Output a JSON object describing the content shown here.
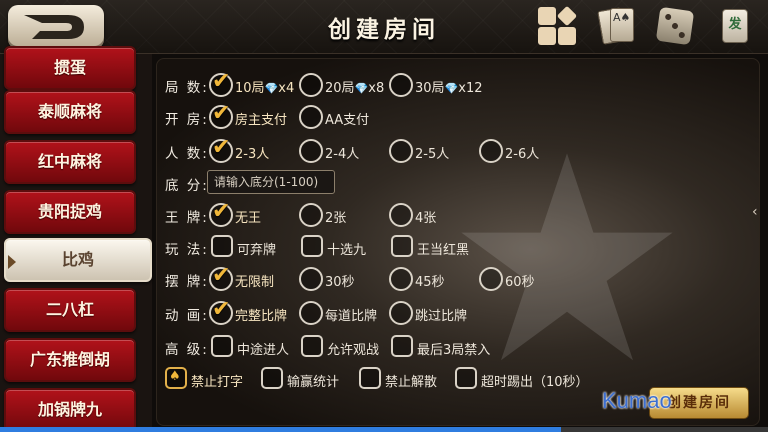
{
  "header": {
    "title": "创建房间",
    "tile_icon_char": "发"
  },
  "sidebar": {
    "items": [
      {
        "label": "掼蛋"
      },
      {
        "label": "泰顺麻将"
      },
      {
        "label": "红中麻将"
      },
      {
        "label": "贵阳捉鸡"
      },
      {
        "label": "比鸡",
        "active": true
      },
      {
        "label": "二八杠"
      },
      {
        "label": "广东推倒胡"
      },
      {
        "label": "加锅牌九"
      }
    ]
  },
  "form": {
    "rounds": {
      "label": "局 数:",
      "options": [
        {
          "text": "10局",
          "gem": "💎",
          "cost": "x4",
          "selected": true
        },
        {
          "text": "20局",
          "gem": "💎",
          "cost": "x8",
          "selected": false
        },
        {
          "text": "30局",
          "gem": "💎",
          "cost": "x12",
          "selected": false
        }
      ]
    },
    "payment": {
      "label": "开 房:",
      "options": [
        {
          "text": "房主支付",
          "selected": true
        },
        {
          "text": "AA支付",
          "selected": false
        }
      ]
    },
    "players": {
      "label": "人 数:",
      "options": [
        {
          "text": "2-3人",
          "selected": true
        },
        {
          "text": "2-4人",
          "selected": false
        },
        {
          "text": "2-5人",
          "selected": false
        },
        {
          "text": "2-6人",
          "selected": false
        }
      ]
    },
    "base_score": {
      "label": "底 分:",
      "placeholder": "请输入底分(1-100)",
      "value": ""
    },
    "wild": {
      "label": "王 牌:",
      "options": [
        {
          "text": "无王",
          "selected": true
        },
        {
          "text": "2张",
          "selected": false
        },
        {
          "text": "4张",
          "selected": false
        }
      ]
    },
    "play": {
      "label": "玩 法:",
      "options": [
        {
          "text": "可弃牌",
          "selected": false
        },
        {
          "text": "十选九",
          "selected": false
        },
        {
          "text": "王当红黑",
          "selected": false
        }
      ]
    },
    "arrange": {
      "label": "摆 牌:",
      "options": [
        {
          "text": "无限制",
          "selected": true
        },
        {
          "text": "30秒",
          "selected": false
        },
        {
          "text": "45秒",
          "selected": false
        },
        {
          "text": "60秒",
          "selected": false
        }
      ]
    },
    "animation": {
      "label": "动 画:",
      "options": [
        {
          "text": "完整比牌",
          "selected": true
        },
        {
          "text": "每道比牌",
          "selected": false
        },
        {
          "text": "跳过比牌",
          "selected": false
        }
      ]
    },
    "advanced": {
      "label": "高 级:",
      "options": [
        {
          "text": "中途进人",
          "selected": false
        },
        {
          "text": "允许观战",
          "selected": false
        },
        {
          "text": "最后3局禁入",
          "selected": false
        }
      ]
    },
    "extras": {
      "options": [
        {
          "text": "禁止打字",
          "selected": true
        },
        {
          "text": "输赢统计",
          "selected": false
        },
        {
          "text": "禁止解散",
          "selected": false
        },
        {
          "text": "超时踢出（10秒）",
          "selected": false
        }
      ]
    },
    "create_label": "创建房间"
  },
  "watermark": "Kumao",
  "progress": 0.73,
  "colors": {
    "accent": "#f0b73a",
    "sidebar_red": "#a30f16",
    "gem_blue": "#37b6ff",
    "progress_blue": "#2f7de0"
  }
}
